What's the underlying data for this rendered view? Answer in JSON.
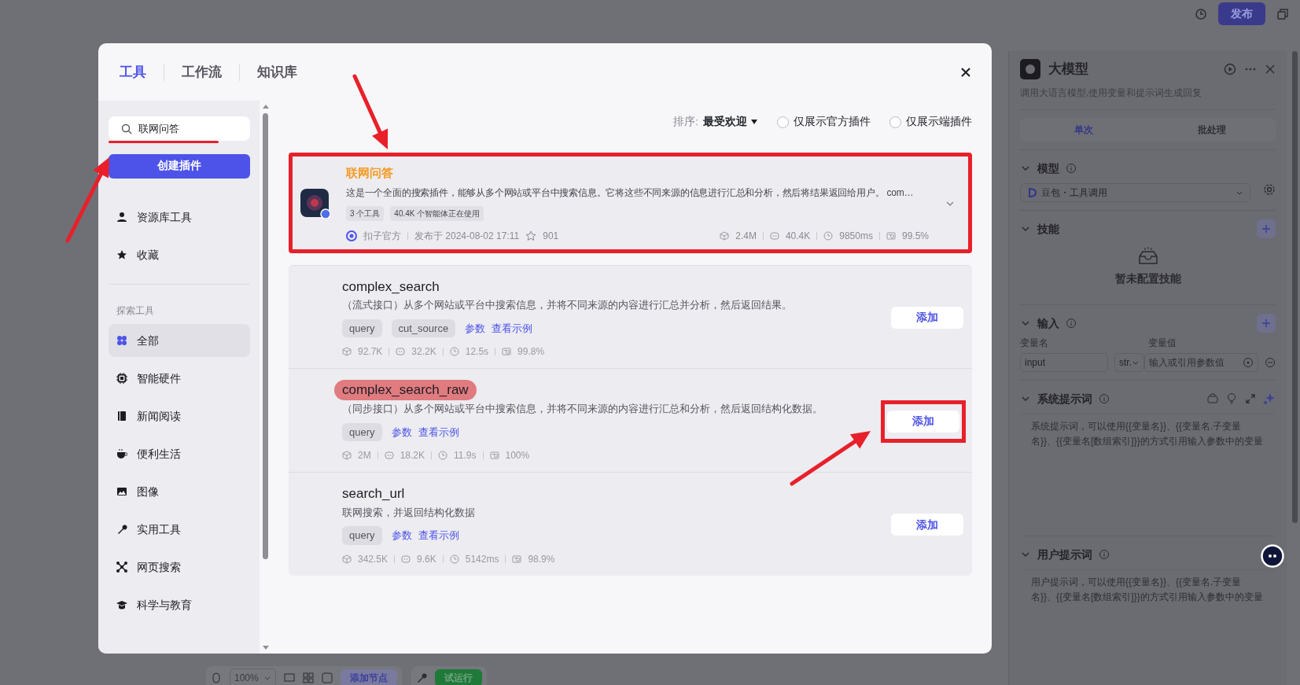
{
  "topbar": {
    "publish_button": "发布"
  },
  "panel": {
    "title": "大模型",
    "description": "调用大语言模型,使用变量和提示词生成回复",
    "tabs": [
      {
        "label": "单次",
        "selected": true
      },
      {
        "label": "批处理",
        "selected": false
      }
    ],
    "sections": [
      {
        "kind": "model",
        "title": "模型",
        "info": true,
        "model": "豆包・工具调用"
      },
      {
        "kind": "skills",
        "title": "技能",
        "info": false,
        "empty_text": "暂未配置技能"
      },
      {
        "kind": "inputs",
        "title": "输入",
        "info": true,
        "columns": [
          "变量名",
          "变量值"
        ],
        "rows": [
          {
            "name": "input",
            "type": "str.",
            "placeholder": "输入或引用参数值"
          }
        ]
      },
      {
        "kind": "prompt",
        "title": "系统提示词",
        "info": true,
        "placeholder": "系统提示词，可以使用{{变量名}}、{{变量名.子变量名}}、{{变量名[数组索引]}}的方式引用输入参数中的变量"
      },
      {
        "kind": "prompt",
        "title": "用户提示词",
        "info": true,
        "placeholder": "用户提示词，可以使用{{变量名}}、{{变量名.子变量名}}、{{变量名[数组索引]}}的方式引用输入参数中的变量"
      }
    ]
  },
  "bottom_toolbar": {
    "zoom": "100%",
    "add_node": "添加节点",
    "run": "试运行"
  },
  "modal": {
    "tabs": [
      {
        "label": "工具",
        "selected": true
      },
      {
        "label": "工作流",
        "selected": false
      },
      {
        "label": "知识库",
        "selected": false
      }
    ],
    "search": {
      "value": "联网问答",
      "underlined": true
    },
    "create_button": "创建插件",
    "nav": [
      {
        "label": "资源库工具",
        "selected": false
      },
      {
        "label": "收藏",
        "selected": false
      }
    ],
    "explore_label": "探索工具",
    "categories": [
      {
        "label": "全部",
        "selected": true
      },
      {
        "label": "智能硬件",
        "selected": false
      },
      {
        "label": "新闻阅读",
        "selected": false
      },
      {
        "label": "便利生活",
        "selected": false
      },
      {
        "label": "图像",
        "selected": false
      },
      {
        "label": "实用工具",
        "selected": false
      },
      {
        "label": "网页搜索",
        "selected": false
      },
      {
        "label": "科学与教育",
        "selected": false
      }
    ],
    "sort": {
      "label": "排序:",
      "value": "最受欢迎"
    },
    "filters": [
      {
        "label": "仅展示官方插件",
        "checked": false
      },
      {
        "label": "仅展示端插件",
        "checked": false
      }
    ],
    "plugin": {
      "name": "联网问答",
      "description": "这是一个全面的搜索插件，能够从多个网站或平台中搜索信息。它将这些不同来源的信息进行汇总和分析，然后将结果返回给用户。 com…",
      "tags": [
        "3 个工具",
        "40.4K 个智能体正在使用"
      ],
      "publisher": "扣子官方",
      "published": "发布于 2024-08-02 17:11",
      "favorites": "901",
      "stats": [
        "2.4M",
        "40.4K",
        "9850ms",
        "99.5%"
      ],
      "expanded": true,
      "framed": true
    },
    "tools": [
      {
        "name": "complex_search",
        "description": "（流式接口）从多个网站或平台中搜索信息，并将不同来源的内容进行汇总并分析，然后返回结果。",
        "params": [
          "query",
          "cut_source"
        ],
        "links": [
          "参数",
          "查看示例"
        ],
        "stats": [
          "92.7K",
          "32.2K",
          "12.5s",
          "99.8%"
        ],
        "add_button": "添加",
        "highlighted": false,
        "framed": false
      },
      {
        "name": "complex_search_raw",
        "description": "（同步接口）从多个网站或平台中搜索信息，并将不同来源的内容进行汇总和分析，然后返回结构化数据。",
        "params": [
          "query"
        ],
        "links": [
          "参数",
          "查看示例"
        ],
        "stats": [
          "2M",
          "18.2K",
          "11.9s",
          "100%"
        ],
        "add_button": "添加",
        "highlighted": true,
        "framed": true
      },
      {
        "name": "search_url",
        "description": "联网搜索，并返回结构化数据",
        "params": [
          "query"
        ],
        "links": [
          "参数",
          "查看示例"
        ],
        "stats": [
          "342.5K",
          "9.6K",
          "5142ms",
          "98.9%"
        ],
        "add_button": "添加",
        "highlighted": false,
        "framed": false
      }
    ]
  }
}
